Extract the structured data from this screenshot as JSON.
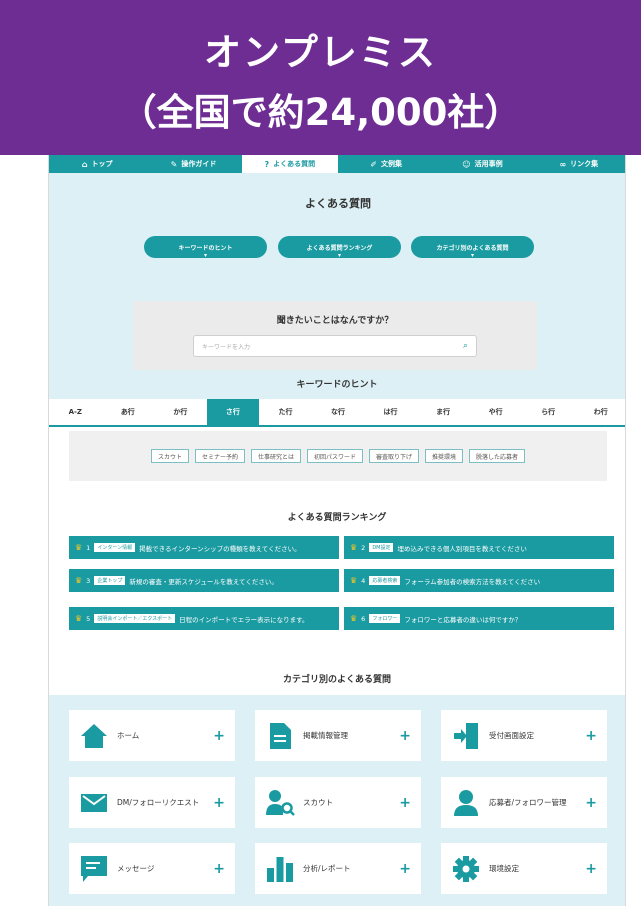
{
  "banner": {
    "line1": "オンプレミス",
    "line2": "（全国で約24,000社）"
  },
  "nav": [
    {
      "icon": "home-icon",
      "label": "トップ"
    },
    {
      "icon": "guide-icon",
      "label": "操作ガイド"
    },
    {
      "icon": "question-icon",
      "label": "よくある質問"
    },
    {
      "icon": "document-icon",
      "label": "文例集"
    },
    {
      "icon": "people-icon",
      "label": "活用事例"
    },
    {
      "icon": "link-icon",
      "label": "リンク集"
    }
  ],
  "header": {
    "title": "よくある質問"
  },
  "pills": [
    "キーワードのヒント",
    "よくある質問ランキング",
    "カテゴリ別のよくある質問"
  ],
  "search": {
    "title": "聞きたいことはなんですか？",
    "placeholder": "キーワードを入力"
  },
  "keywords": {
    "title": "キーワードのヒント",
    "tabs": [
      "A-Z",
      "あ行",
      "か行",
      "さ行",
      "た行",
      "な行",
      "は行",
      "ま行",
      "や行",
      "ら行",
      "わ行"
    ],
    "active_tab": "さ行",
    "chips": [
      "スカウト",
      "セミナー予約",
      "仕事研究とは",
      "初回パスワード",
      "審査取り下げ",
      "推奨環境",
      "脱落した応募者"
    ]
  },
  "ranking": {
    "title": "よくある質問ランキング",
    "items": [
      {
        "no": "1",
        "tag": "インターン情報",
        "text": "掲載できるインターンシップの種類を教えてください。"
      },
      {
        "no": "2",
        "tag": "DM設定",
        "text": "埋め込みできる個人別項目を教えてください"
      },
      {
        "no": "3",
        "tag": "企業トップ",
        "text": "新規の審査・更新スケジュールを教えてください。"
      },
      {
        "no": "4",
        "tag": "応募者検索",
        "text": "フォーラム参加者の検索方法を教えてください"
      },
      {
        "no": "5",
        "tag": "説明会インポート／エクスポート",
        "text": "日程のインポートでエラー表示になります。"
      },
      {
        "no": "6",
        "tag": "フォロワー",
        "text": "フォロワーと応募者の違いは何ですか？"
      }
    ]
  },
  "categories": {
    "title": "カテゴリ別のよくある質問",
    "items": [
      {
        "icon": "home-icon",
        "label": "ホーム"
      },
      {
        "icon": "document-icon",
        "label": "掲載情報管理"
      },
      {
        "icon": "entrance-icon",
        "label": "受付画面設定"
      },
      {
        "icon": "mail-icon",
        "label": "DM/フォローリクエスト"
      },
      {
        "icon": "scout-icon",
        "label": "スカウト"
      },
      {
        "icon": "person-icon",
        "label": "応募者/フォロワー管理"
      },
      {
        "icon": "chat-icon",
        "label": "メッセージ"
      },
      {
        "icon": "chart-icon",
        "label": "分析/レポート"
      },
      {
        "icon": "gear-icon",
        "label": "環境設定"
      }
    ]
  },
  "colors": {
    "banner": "#6e2d93",
    "teal": "#1a9ba1",
    "light_bg": "#dcf0f5",
    "crown": "#f3c623"
  }
}
